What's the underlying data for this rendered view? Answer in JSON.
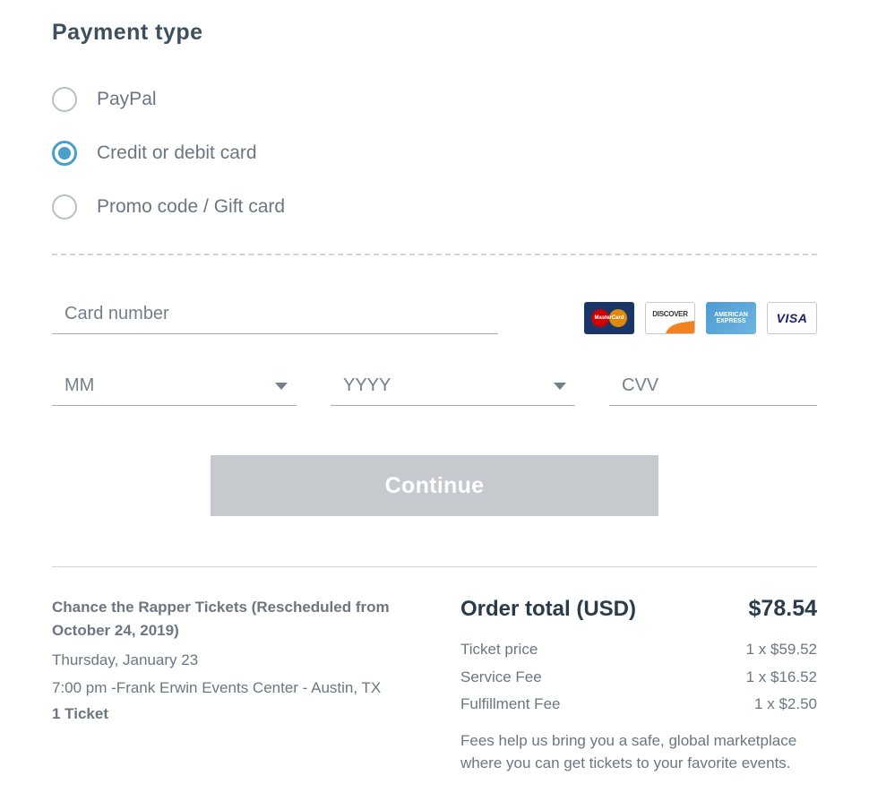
{
  "section_title": "Payment type",
  "payment_options": [
    {
      "id": "paypal",
      "label": "PayPal",
      "selected": false
    },
    {
      "id": "card",
      "label": "Credit or debit card",
      "selected": true
    },
    {
      "id": "promo",
      "label": "Promo code / Gift card",
      "selected": false
    }
  ],
  "card_form": {
    "card_number_placeholder": "Card number",
    "mm_placeholder": "MM",
    "yyyy_placeholder": "YYYY",
    "cvv_placeholder": "CVV"
  },
  "card_brands": {
    "mastercard": "MasterCard",
    "discover": "DISCOVER",
    "amex": "AMERICAN EXPRESS",
    "visa": "VISA"
  },
  "continue_label": "Continue",
  "order": {
    "event_title": "Chance the Rapper Tickets (Rescheduled from October 24, 2019)",
    "date_line": "Thursday, January 23",
    "time_venue": "7:00 pm -Frank Erwin Events Center - Austin, TX",
    "ticket_count": "1 Ticket",
    "total_label": "Order total (USD)",
    "total_value": "$78.54",
    "lines": [
      {
        "label": "Ticket price",
        "value": "1 x $59.52"
      },
      {
        "label": "Service Fee",
        "value": "1 x $16.52"
      },
      {
        "label": "Fulfillment Fee",
        "value": "1 x $2.50"
      }
    ],
    "fees_note": "Fees help us bring you a safe, global marketplace where you can get tickets to your favorite events."
  }
}
